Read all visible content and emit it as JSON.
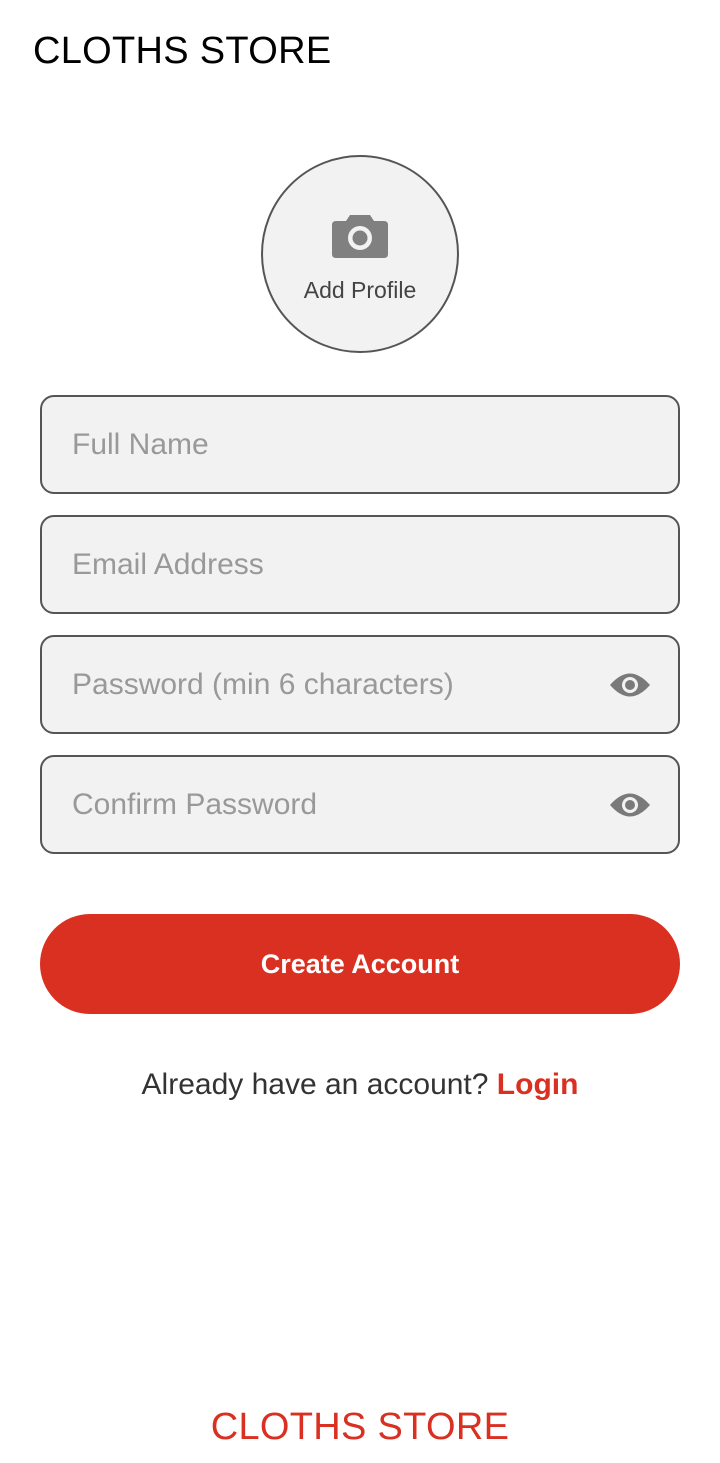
{
  "header": {
    "title": "CLOTHS STORE"
  },
  "profile": {
    "label": "Add Profile",
    "icon": "camera-icon"
  },
  "form": {
    "full_name": {
      "placeholder": "Full Name",
      "value": ""
    },
    "email": {
      "placeholder": "Email Address",
      "value": ""
    },
    "password": {
      "placeholder": "Password (min 6 characters)",
      "value": "",
      "icon": "eye-icon"
    },
    "confirm_password": {
      "placeholder": "Confirm Password",
      "value": "",
      "icon": "eye-icon"
    }
  },
  "actions": {
    "create_label": "Create Account"
  },
  "login_prompt": {
    "text": "Already have an account? ",
    "link": "Login"
  },
  "footer": {
    "brand": "CLOTHS STORE"
  },
  "colors": {
    "accent": "#d93021",
    "field_bg": "#f2f2f2",
    "border": "#555555",
    "placeholder": "#999999"
  }
}
